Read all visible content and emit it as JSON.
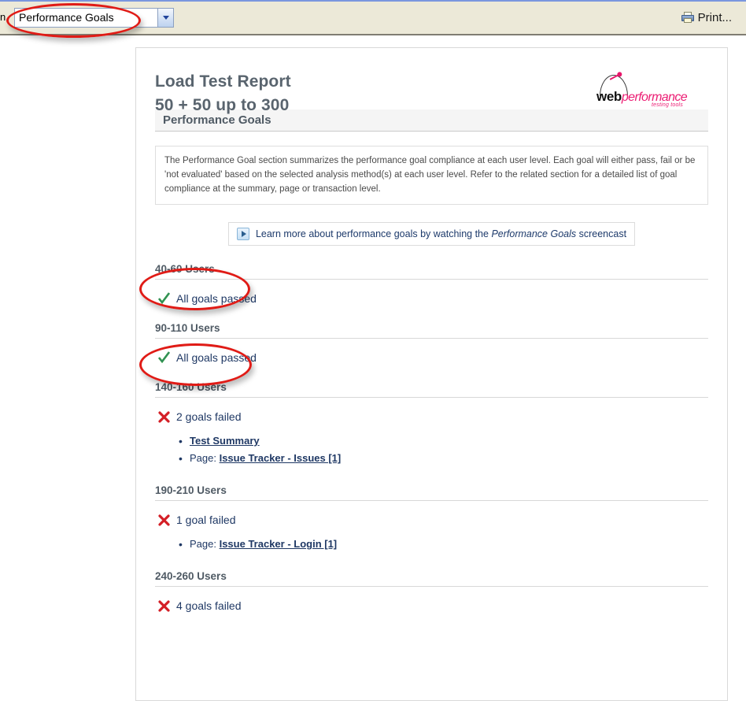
{
  "toolbar": {
    "left_partial_text": "n",
    "combo": {
      "value": "Performance Goals",
      "arrow_icon": "chevron-down-icon"
    },
    "print": {
      "label": "Print...",
      "icon": "printer-icon"
    }
  },
  "report": {
    "title": "Load Test Report",
    "subtitle": "50 + 50 up to 300",
    "logo": {
      "word_primary": "web",
      "word_secondary": "performance",
      "tagline": "testing tools",
      "icon": "speedometer-icon",
      "accent_color": "#ec1c73"
    },
    "section": {
      "header": "Performance Goals",
      "description": "The Performance Goal section summarizes the performance goal compliance at each user level. Each goal will either pass, fail or be 'not evaluated' based on the selected analysis method(s) at each user level. Refer to the related section for a detailed list of goal compliance at the summary, page or transaction level."
    },
    "screencast": {
      "icon": "play-icon",
      "text_before": "Learn more about performance goals by watching the",
      "text_emphasis": "Performance Goals",
      "text_after": "screencast"
    },
    "levels": [
      {
        "heading": "40-60 Users",
        "status_icon": "green-check-icon",
        "status_text": "All goals passed",
        "goals": []
      },
      {
        "heading": "90-110 Users",
        "status_icon": "green-check-icon",
        "status_text": "All goals passed",
        "goals": []
      },
      {
        "heading": "140-160 Users",
        "status_icon": "red-x-icon",
        "status_text": "2 goals failed",
        "goals": [
          {
            "prefix": "",
            "link": "Test Summary"
          },
          {
            "prefix": "Page: ",
            "link": "Issue Tracker - Issues [1]"
          }
        ]
      },
      {
        "heading": "190-210 Users",
        "status_icon": "red-x-icon",
        "status_text": "1 goal failed",
        "goals": [
          {
            "prefix": "Page: ",
            "link": "Issue Tracker - Login [1]"
          }
        ]
      },
      {
        "heading": "240-260 Users",
        "status_icon": "red-x-icon",
        "status_text": "4 goals failed",
        "goals": []
      }
    ]
  },
  "annotations": {
    "color": "#e01b16",
    "shapes": [
      {
        "name": "combo-highlight"
      },
      {
        "name": "level-40-60-highlight"
      },
      {
        "name": "level-90-110-highlight"
      }
    ]
  }
}
